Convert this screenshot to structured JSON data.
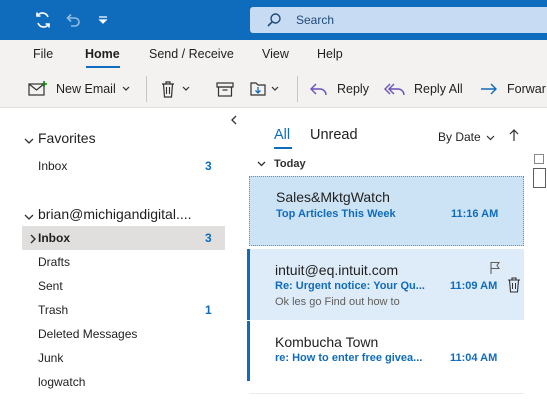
{
  "titlebar": {
    "search_placeholder": "Search",
    "icons": [
      "sync-icon",
      "undo-icon",
      "customize-caret-icon",
      "search-icon"
    ]
  },
  "menu": {
    "tabs": [
      {
        "label": "File"
      },
      {
        "label": "Home",
        "active": true
      },
      {
        "label": "Send / Receive"
      },
      {
        "label": "View"
      },
      {
        "label": "Help"
      }
    ]
  },
  "ribbon": {
    "new_email": "New Email",
    "reply": "Reply",
    "reply_all": "Reply All",
    "forward": "Forwar"
  },
  "nav": {
    "favorites": {
      "label": "Favorites",
      "folders": [
        {
          "label": "Inbox",
          "count": "3"
        }
      ]
    },
    "account": {
      "label": "brian@michigandigital....",
      "folders": [
        {
          "label": "Inbox",
          "count": "3",
          "selected": true
        },
        {
          "label": "Drafts",
          "count": ""
        },
        {
          "label": "Sent",
          "count": ""
        },
        {
          "label": "Trash",
          "count": "1"
        },
        {
          "label": "Deleted Messages",
          "count": ""
        },
        {
          "label": "Junk",
          "count": ""
        },
        {
          "label": "logwatch",
          "count": ""
        }
      ]
    }
  },
  "list": {
    "filter_all": "All",
    "filter_unread": "Unread",
    "sort_label": "By Date",
    "group": "Today",
    "messages": [
      {
        "from": "Sales&MktgWatch",
        "subject": "Top Articles This Week",
        "time": "11:16 AM",
        "preview": "",
        "selected": true
      },
      {
        "from": "intuit@eq.intuit.com",
        "subject": "Re: Urgent notice: Your Qu...",
        "time": "11:09 AM",
        "preview": "Ok les go Find out how to",
        "hover": true
      },
      {
        "from": "Kombucha Town",
        "subject": "re: How to enter free givea...",
        "time": "11:04 AM",
        "preview": ""
      }
    ]
  },
  "colors": {
    "brand": "#0f6cbd",
    "selected_row": "#cce3f5",
    "hover_row": "#deecf9"
  }
}
